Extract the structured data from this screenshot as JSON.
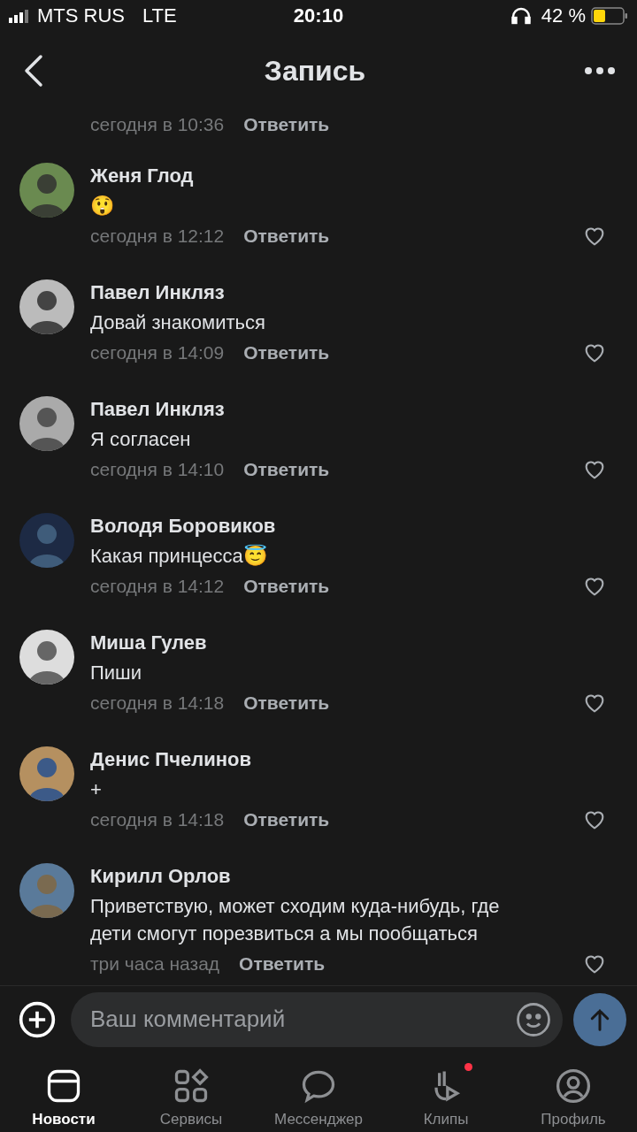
{
  "status_bar": {
    "carrier": "MTS RUS",
    "network": "LTE",
    "time": "20:10",
    "battery_text": "42 %"
  },
  "header": {
    "title": "Запись"
  },
  "partial_comment": {
    "time": "сегодня в 10:36",
    "reply": "Ответить"
  },
  "comments": [
    {
      "author": "Женя Глод",
      "text": "😲",
      "time": "сегодня в 12:12",
      "reply": "Ответить",
      "liked": false
    },
    {
      "author": "Павел Инкляз",
      "text": "Довай знакомиться",
      "time": "сегодня в 14:09",
      "reply": "Ответить",
      "liked": false
    },
    {
      "author": "Павел Инкляз",
      "text": "Я согласен",
      "time": "сегодня в 14:10",
      "reply": "Ответить",
      "liked": false
    },
    {
      "author": "Володя Боровиков",
      "text": "Какая принцесса😇",
      "time": "сегодня в 14:12",
      "reply": "Ответить",
      "liked": false
    },
    {
      "author": "Миша Гулев",
      "text": "Пиши",
      "time": "сегодня в 14:18",
      "reply": "Ответить",
      "liked": false
    },
    {
      "author": "Денис Пчелинов",
      "text": "+",
      "time": "сегодня в 14:18",
      "reply": "Ответить",
      "liked": false
    },
    {
      "author": "Кирилл Орлов",
      "text": "Приветствую, может сходим куда-нибудь, где дети смогут порезвиться а мы пообщаться",
      "time": "три часа назад",
      "reply": "Ответить",
      "liked": false
    }
  ],
  "composer": {
    "placeholder": "Ваш комментарий"
  },
  "tabs": [
    {
      "label": "Новости",
      "kind": "news",
      "selected": true,
      "dot": false
    },
    {
      "label": "Сервисы",
      "kind": "services",
      "selected": false,
      "dot": false
    },
    {
      "label": "Мессенджер",
      "kind": "messenger",
      "selected": false,
      "dot": false
    },
    {
      "label": "Клипы",
      "kind": "clips",
      "selected": false,
      "dot": true
    },
    {
      "label": "Профиль",
      "kind": "profile",
      "selected": false,
      "dot": false
    }
  ]
}
